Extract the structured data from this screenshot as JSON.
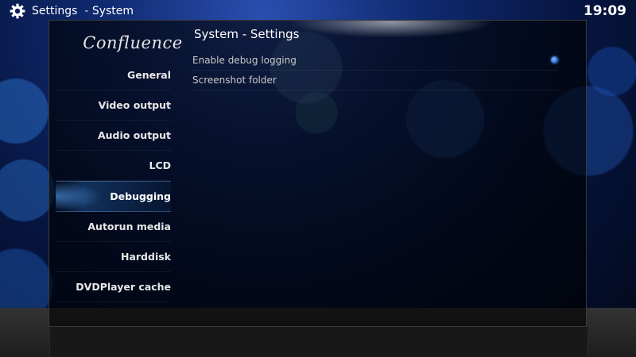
{
  "header": {
    "section": "Settings",
    "separator": "-",
    "page": "System",
    "clock": "19:09"
  },
  "panel": {
    "logo": "Confluence",
    "title": "System - Settings"
  },
  "sidebar": {
    "items": [
      {
        "label": "General"
      },
      {
        "label": "Video output"
      },
      {
        "label": "Audio output"
      },
      {
        "label": "LCD"
      },
      {
        "label": "Debugging",
        "selected": true
      },
      {
        "label": "Autorun media"
      },
      {
        "label": "Harddisk"
      },
      {
        "label": "DVDPlayer cache"
      }
    ]
  },
  "settings": {
    "items": [
      {
        "label": "Enable debug logging",
        "enabled": true
      },
      {
        "label": "Screenshot folder"
      }
    ]
  },
  "colors": {
    "accent": "#2f6fd0",
    "background": "#061540"
  }
}
